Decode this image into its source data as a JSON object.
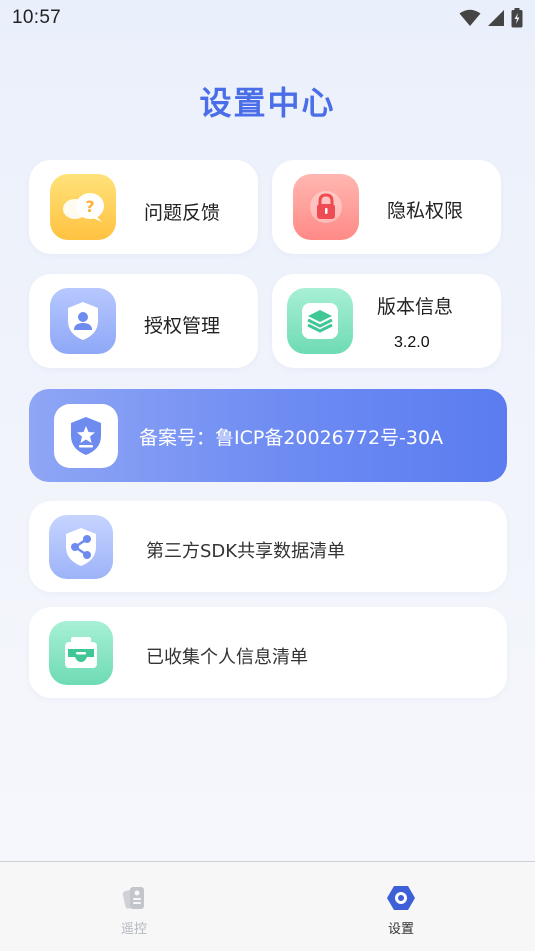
{
  "status_bar": {
    "time": "10:57"
  },
  "header": {
    "title": "设置中心"
  },
  "tiles": [
    {
      "label": "问题反馈",
      "icon": "question-chat-icon"
    },
    {
      "label": "隐私权限",
      "icon": "lock-icon"
    },
    {
      "label": "授权管理",
      "icon": "user-shield-icon"
    },
    {
      "label": "版本信息",
      "version": "3.2.0",
      "icon": "layers-icon"
    }
  ],
  "banner": {
    "text": "备案号：鲁ICP备20026772号-30A",
    "icon": "star-shield-icon"
  },
  "list": [
    {
      "label": "第三方SDK共享数据清单",
      "icon": "share-icon"
    },
    {
      "label": "已收集个人信息清单",
      "icon": "inbox-tray-icon"
    }
  ],
  "bottom_nav": [
    {
      "label": "遥控",
      "icon": "remote-icon",
      "active": false
    },
    {
      "label": "设置",
      "icon": "settings-hex-icon",
      "active": true
    }
  ],
  "colors": {
    "accent": "#4a6ee8",
    "nav_active": "#3d5fd8",
    "nav_inactive": "#b5b8c0"
  }
}
